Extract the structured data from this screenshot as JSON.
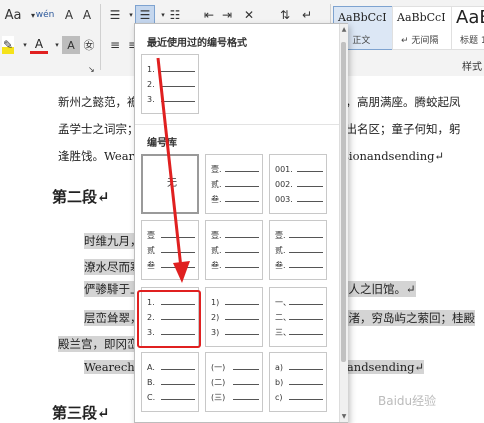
{
  "ribbon": {
    "font_size_btn": "Aa",
    "phonetic_btn": "wén",
    "styles_group_label": "样式",
    "styles": [
      {
        "preview": "AaBbCcI",
        "name": "↵ 正文"
      },
      {
        "preview": "AaBbCcI",
        "name": "↵ 无间隔"
      },
      {
        "preview": "AaB",
        "name": "标题 1"
      }
    ],
    "colors": {
      "highlight": "#f5e21a",
      "font_color": "#e02020",
      "accent": "#2b579a"
    }
  },
  "document": {
    "lines": [
      {
        "text": "新州之懿范，襜帷暂驻。十旬休假，胜友如云；千里逢迎，高朋满座。腾蛟起凤",
        "highlight": false
      },
      {
        "text": "孟学士之词宗；紫电青霜，王将军之武库。家君作宰，路出名区；童子何知，躬",
        "highlight": false
      },
      {
        "text": "逢胜饯。Wearechoosingtotakethemomentoverdivisionandsending↵",
        "highlight": false
      }
    ],
    "heading2": "第二段↵",
    "para2": [
      {
        "text": "时维九月，序属三秋。",
        "highlight": true
      },
      {
        "text": "潦水尽而寒潭清，烟光凝而暮山紫。",
        "highlight": true
      },
      {
        "text": "俨骖騑于上路，访风景于崇阿。临帝子之长洲，得天人之旧馆。↵",
        "highlight": true
      },
      {
        "text": "层峦耸翠，上出重霄；飞阁流丹，下临无地。鹤汀凫渚，穷岛屿之萦回；桂殿",
        "highlight": true
      },
      {
        "text": "殿兰宫，即冈峦之体势。",
        "highlight": true
      },
      {
        "text": "Wearechoosingtotakethemomentoverdivisionandsending↵",
        "highlight": true
      }
    ],
    "heading3": "第三段↵"
  },
  "panel": {
    "recent_title": "最近使用过的编号格式",
    "library_title": "编号库",
    "none_label": "无",
    "recent": [
      {
        "markers": [
          "1.",
          "2.",
          "3."
        ]
      }
    ],
    "library": [
      [
        {
          "none": true,
          "markers": []
        },
        {
          "markers": [
            "壹.",
            "贰.",
            "叁."
          ]
        },
        {
          "markers": [
            "001.",
            "002.",
            "003."
          ]
        }
      ],
      [
        {
          "markers": [
            "壹",
            "贰",
            "叁"
          ]
        },
        {
          "markers": [
            "壹.",
            "贰.",
            "叁."
          ]
        },
        {
          "markers": [
            "壹.",
            "贰.",
            "叁."
          ]
        }
      ],
      [
        {
          "markers": [
            "1.",
            "2.",
            "3."
          ],
          "selected": true
        },
        {
          "markers": [
            "1)",
            "2)",
            "3)"
          ]
        },
        {
          "markers": [
            "一、",
            "二、",
            "三、"
          ]
        }
      ],
      [
        {
          "markers": [
            "A.",
            "B.",
            "C."
          ]
        },
        {
          "markers": [
            "(一)",
            "(二)",
            "(三)"
          ]
        },
        {
          "markers": [
            "a)",
            "b)",
            "c)"
          ]
        }
      ]
    ]
  },
  "watermark": "Baidu经验"
}
